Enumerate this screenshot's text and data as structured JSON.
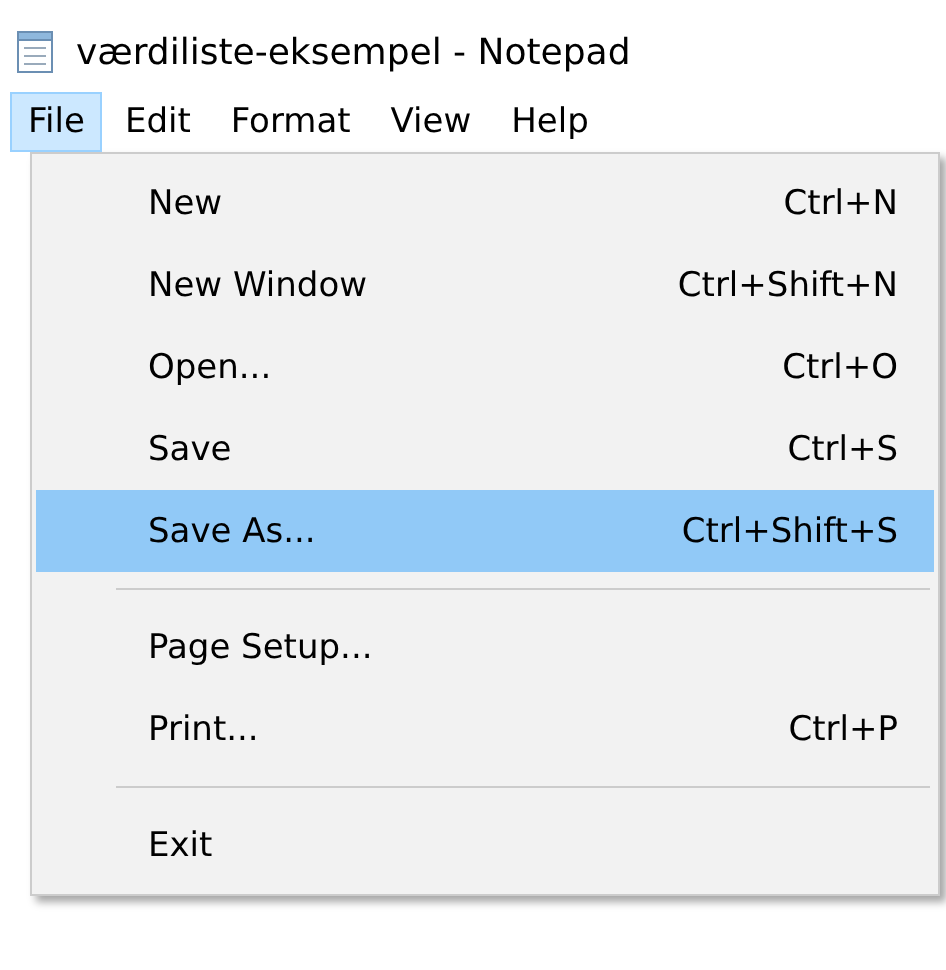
{
  "window": {
    "title": "værdiliste-eksempel - Notepad"
  },
  "menu_bar": [
    {
      "label": "File",
      "selected": true
    },
    {
      "label": "Edit",
      "selected": false
    },
    {
      "label": "Format",
      "selected": false
    },
    {
      "label": "View",
      "selected": false
    },
    {
      "label": "Help",
      "selected": false
    }
  ],
  "dropdown": [
    {
      "kind": "item",
      "label": "New",
      "shortcut": "Ctrl+N",
      "selected": false
    },
    {
      "kind": "item",
      "label": "New Window",
      "shortcut": "Ctrl+Shift+N",
      "selected": false
    },
    {
      "kind": "item",
      "label": "Open...",
      "shortcut": "Ctrl+O",
      "selected": false
    },
    {
      "kind": "item",
      "label": "Save",
      "shortcut": "Ctrl+S",
      "selected": false
    },
    {
      "kind": "item",
      "label": "Save As...",
      "shortcut": "Ctrl+Shift+S",
      "selected": true
    },
    {
      "kind": "separator"
    },
    {
      "kind": "item",
      "label": "Page Setup...",
      "selected": false
    },
    {
      "kind": "item",
      "label": "Print...",
      "shortcut": "Ctrl+P",
      "selected": false
    },
    {
      "kind": "separator"
    },
    {
      "kind": "item",
      "label": "Exit",
      "selected": false
    }
  ]
}
